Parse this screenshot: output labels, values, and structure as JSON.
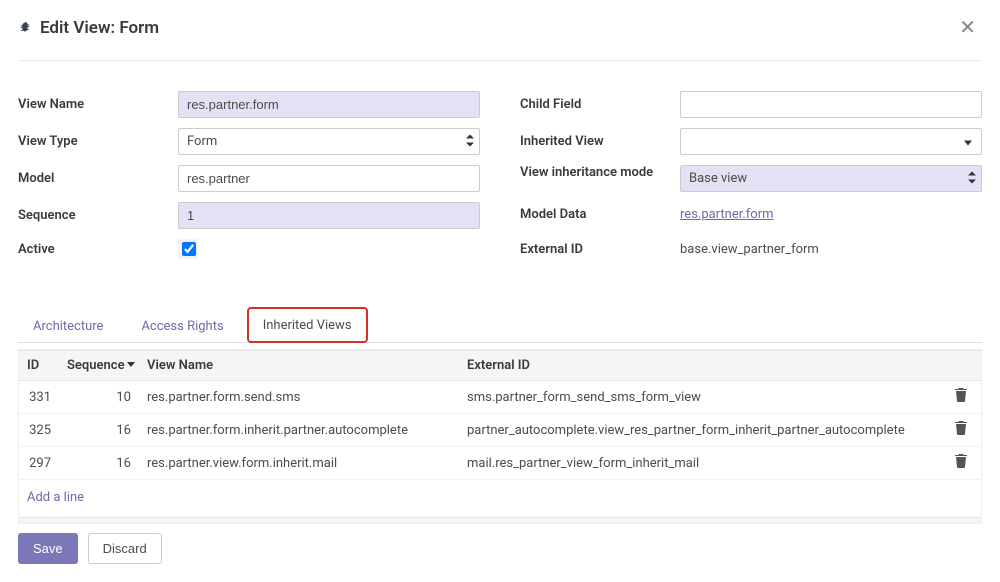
{
  "dialog": {
    "title": "Edit View: Form"
  },
  "form_left": {
    "view_name_label": "View Name",
    "view_name_value": "res.partner.form",
    "view_type_label": "View Type",
    "view_type_value": "Form",
    "model_label": "Model",
    "model_value": "res.partner",
    "sequence_label": "Sequence",
    "sequence_value": "1",
    "active_label": "Active",
    "active_value": true
  },
  "form_right": {
    "child_field_label": "Child Field",
    "child_field_value": "",
    "inherited_view_label": "Inherited View",
    "inherited_view_value": "",
    "inheritance_mode_label": "View inheritance mode",
    "inheritance_mode_value": "Base view",
    "model_data_label": "Model Data",
    "model_data_value": "res.partner.form",
    "external_id_label": "External ID",
    "external_id_value": "base.view_partner_form"
  },
  "tabs": {
    "architecture": "Architecture",
    "access_rights": "Access Rights",
    "inherited_views": "Inherited Views"
  },
  "table": {
    "headers": {
      "id": "ID",
      "sequence": "Sequence",
      "view_name": "View Name",
      "external_id": "External ID"
    },
    "rows": [
      {
        "id": "331",
        "seq": "10",
        "name": "res.partner.form.send.sms",
        "ext": "sms.partner_form_send_sms_form_view"
      },
      {
        "id": "325",
        "seq": "16",
        "name": "res.partner.form.inherit.partner.autocomplete",
        "ext": "partner_autocomplete.view_res_partner_form_inherit_partner_autocomplete"
      },
      {
        "id": "297",
        "seq": "16",
        "name": "res.partner.view.form.inherit.mail",
        "ext": "mail.res_partner_view_form_inherit_mail"
      }
    ],
    "add_line": "Add a line"
  },
  "footer": {
    "save": "Save",
    "discard": "Discard"
  }
}
